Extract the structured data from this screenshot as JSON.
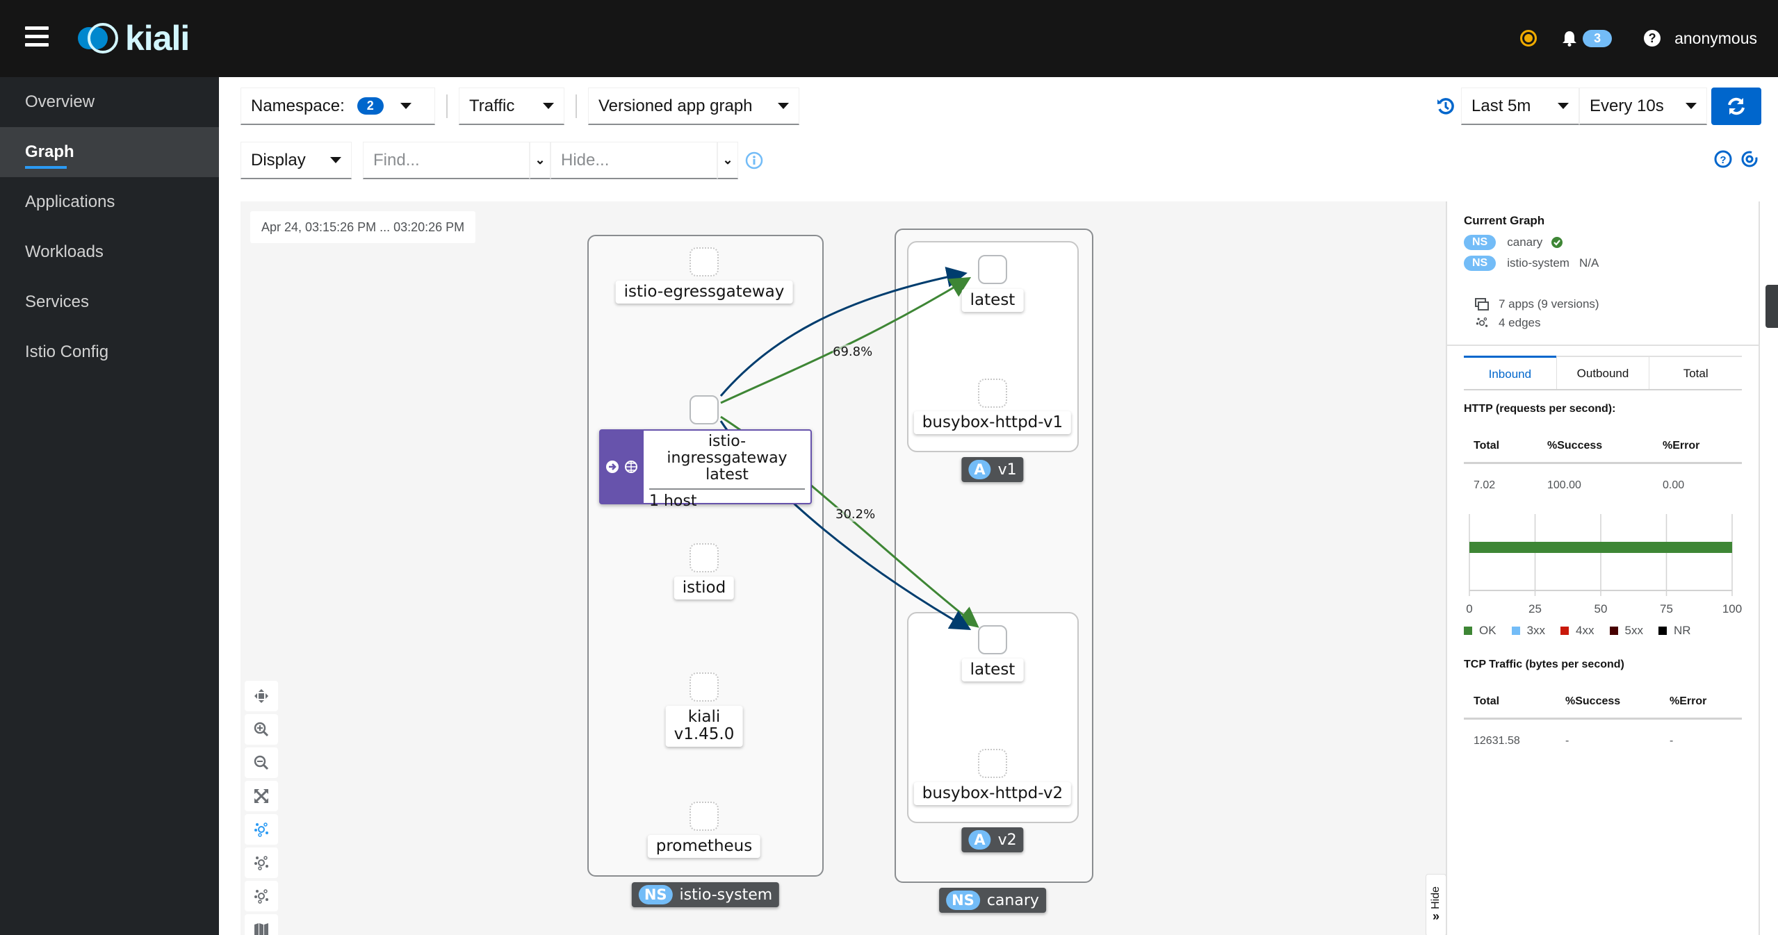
{
  "header": {
    "brand": "kiali",
    "notification_count": "3",
    "user": "anonymous",
    "status_color": "#f0ab00"
  },
  "sidebar": {
    "items": [
      {
        "label": "Overview",
        "active": false
      },
      {
        "label": "Graph",
        "active": true
      },
      {
        "label": "Applications",
        "active": false
      },
      {
        "label": "Workloads",
        "active": false
      },
      {
        "label": "Services",
        "active": false
      },
      {
        "label": "Istio Config",
        "active": false
      }
    ]
  },
  "toolbar": {
    "namespace_label": "Namespace:",
    "namespace_count": "2",
    "traffic_label": "Traffic",
    "graph_type": "Versioned app graph",
    "duration": "Last 5m",
    "refresh_interval": "Every 10s",
    "display_label": "Display",
    "find_placeholder": "Find...",
    "hide_placeholder": "Hide..."
  },
  "graph": {
    "time_range": "Apr 24, 03:15:26 PM ... 03:20:26 PM",
    "namespaces": [
      {
        "name": "istio-system",
        "tag": "NS"
      },
      {
        "name": "canary",
        "tag": "NS"
      }
    ],
    "apps": [
      {
        "tag": "A",
        "version": "v1"
      },
      {
        "tag": "A",
        "version": "v2"
      }
    ],
    "nodes": [
      {
        "label": "istio-egressgateway",
        "namespace": "istio-system",
        "unused": true
      },
      {
        "label": "istio-ingressgateway",
        "sublabel": "latest",
        "detail": "1 host",
        "namespace": "istio-system",
        "unused": false
      },
      {
        "label": "istiod",
        "namespace": "istio-system",
        "unused": true
      },
      {
        "label": "kiali",
        "sublabel": "v1.45.0",
        "namespace": "istio-system",
        "unused": true
      },
      {
        "label": "prometheus",
        "namespace": "istio-system",
        "unused": true
      },
      {
        "label": "latest",
        "namespace": "canary",
        "app": "v1",
        "unused": false
      },
      {
        "label": "busybox-httpd-v1",
        "namespace": "canary",
        "app": "v1",
        "unused": true
      },
      {
        "label": "latest",
        "namespace": "canary",
        "app": "v2",
        "unused": false
      },
      {
        "label": "busybox-httpd-v2",
        "namespace": "canary",
        "app": "v2",
        "unused": true
      }
    ],
    "edges": [
      {
        "from": "istio-ingressgateway",
        "to": "v1-latest",
        "protocol": "http",
        "label": "69.8%",
        "color": "#3e8635"
      },
      {
        "from": "istio-ingressgateway",
        "to": "v1-latest",
        "protocol": "tcp",
        "label": "",
        "color": "#003d6e"
      },
      {
        "from": "istio-ingressgateway",
        "to": "v2-latest",
        "protocol": "http",
        "label": "30.2%",
        "color": "#3e8635"
      },
      {
        "from": "istio-ingressgateway",
        "to": "v2-latest",
        "protocol": "tcp",
        "label": "",
        "color": "#003d6e"
      }
    ],
    "hide_tab_label": "Hide"
  },
  "side_panel": {
    "title": "Current Graph",
    "namespaces": [
      {
        "tag": "NS",
        "name": "canary",
        "status": "healthy"
      },
      {
        "tag": "NS",
        "name": "istio-system",
        "status": "N/A"
      }
    ],
    "apps_summary": "7 apps (9 versions)",
    "edges_summary": "4 edges",
    "tabs": [
      "Inbound",
      "Outbound",
      "Total"
    ],
    "active_tab": "Inbound",
    "http": {
      "title": "HTTP (requests per second):",
      "headers": [
        "Total",
        "%Success",
        "%Error"
      ],
      "values": [
        "7.02",
        "100.00",
        "0.00"
      ]
    },
    "tcp": {
      "title": "TCP Traffic (bytes per second)",
      "headers": [
        "Total",
        "%Success",
        "%Error"
      ],
      "values": [
        "12631.58",
        "-",
        "-"
      ]
    }
  },
  "chart_data": {
    "type": "bar",
    "orientation": "horizontal",
    "stacked": true,
    "categories": [
      ""
    ],
    "series": [
      {
        "name": "OK",
        "values": [
          100
        ],
        "color": "#3e8635"
      },
      {
        "name": "3xx",
        "values": [
          0
        ],
        "color": "#73bcf7"
      },
      {
        "name": "4xx",
        "values": [
          0
        ],
        "color": "#c9190b"
      },
      {
        "name": "5xx",
        "values": [
          0
        ],
        "color": "#470000"
      },
      {
        "name": "NR",
        "values": [
          0
        ],
        "color": "#000000"
      }
    ],
    "xlim": [
      0,
      100
    ],
    "xticks": [
      "0",
      "25",
      "50",
      "75",
      "100"
    ],
    "grid": true,
    "legend": "bottom",
    "title": "",
    "xlabel": "",
    "ylabel": ""
  }
}
